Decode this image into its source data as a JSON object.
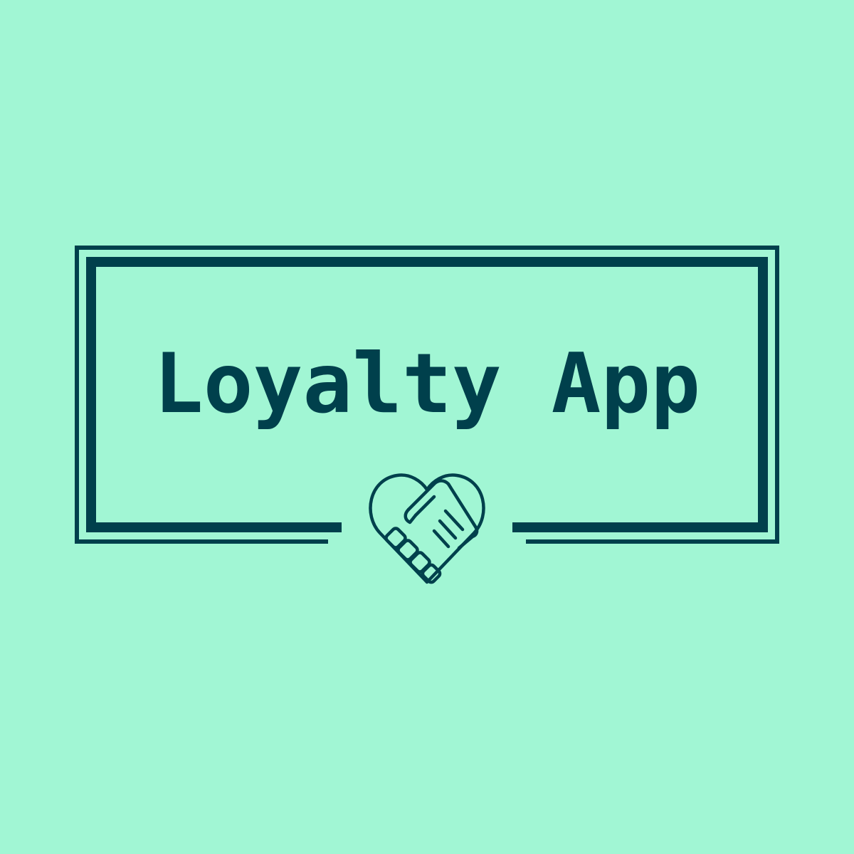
{
  "logo": {
    "title": "Loyalty App",
    "icon": "handshake-heart-icon"
  },
  "colors": {
    "background": "#a1f6d4",
    "primary": "#00404c"
  }
}
